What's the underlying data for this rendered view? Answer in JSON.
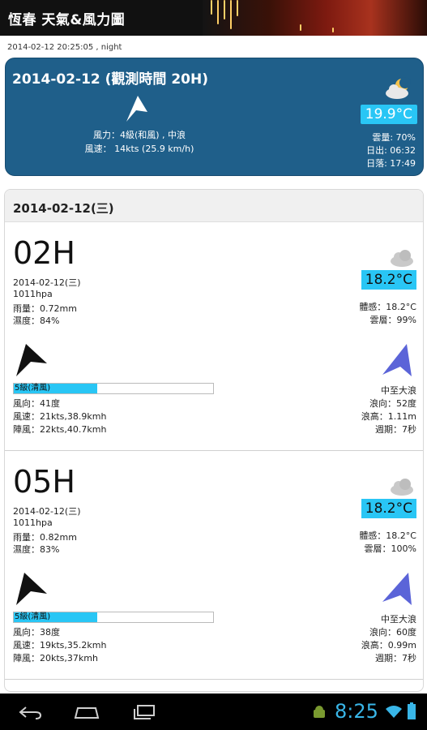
{
  "app": {
    "title": "恆春 天氣&風力圖"
  },
  "timestamp": "2014-02-12 20:25:05 , night",
  "current": {
    "heading": "2014-02-12 (觀測時間 20H)",
    "wind_line1": "風力：4級(和風) , 中浪",
    "wind_line2": "風速： 14kts (25.9 km/h)",
    "temp": "19.9°C",
    "cloud": "雲量: 70%",
    "sunrise": "日出: 06:32",
    "sunset": "日落: 17:49",
    "icon": "cloud-moon-icon"
  },
  "day": {
    "label": "2014-02-12(三)"
  },
  "hours": [
    {
      "time": "02H",
      "date": "2014-02-12(三)",
      "pressure": "1011hpa",
      "rain": "雨量：0.72mm",
      "humidity": "濕度：84%",
      "temp": "18.2°C",
      "feels": "體感：18.2°C",
      "cloud": "雲層：99%",
      "wind_level": "5級(清風)",
      "wind_fraction": 0.42,
      "wind_dir": "風向：41度",
      "wind_speed": "風速：21kts,38.9kmh",
      "gust": "陣風：22kts,40.7kmh",
      "wave_desc": "中至大浪",
      "wave_dir": "浪向：52度",
      "wave_height": "浪高：1.11m",
      "wave_period": "週期：7秒"
    },
    {
      "time": "05H",
      "date": "2014-02-12(三)",
      "pressure": "1011hpa",
      "rain": "雨量：0.82mm",
      "humidity": "濕度：83%",
      "temp": "18.2°C",
      "feels": "體感：18.2°C",
      "cloud": "雲層：100%",
      "wind_level": "5級(清風)",
      "wind_fraction": 0.42,
      "wind_dir": "風向：38度",
      "wind_speed": "風速：19kts,35.2kmh",
      "gust": "陣風：20kts,37kmh",
      "wave_desc": "中至大浪",
      "wave_dir": "浪向：60度",
      "wave_height": "浪高：0.99m",
      "wave_period": "週期：7秒"
    }
  ],
  "status": {
    "time": "8:25"
  },
  "colors": {
    "card_blue": "#1f5f8a",
    "temp_box": "#29c6f5",
    "wave_arrow": "#5b64d8"
  }
}
